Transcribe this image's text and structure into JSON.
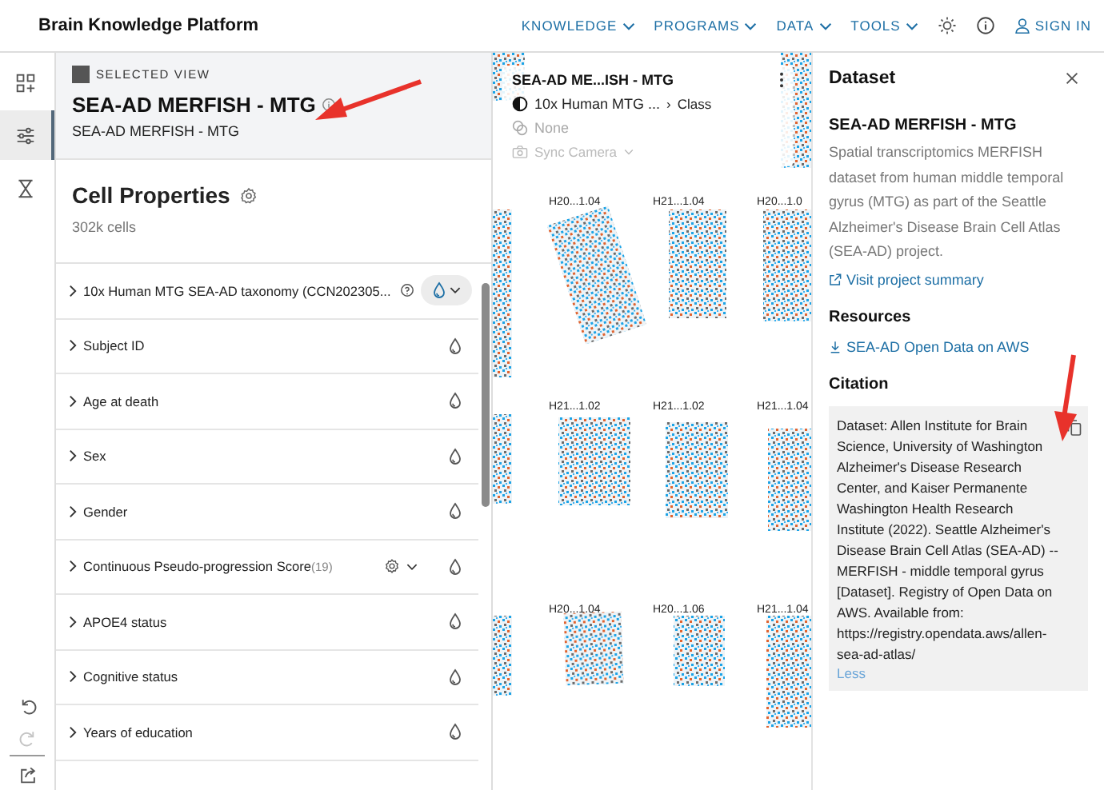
{
  "header": {
    "brand": "Brain Knowledge Platform",
    "nav": [
      {
        "label": "KNOWLEDGE"
      },
      {
        "label": "PROGRAMS"
      },
      {
        "label": "DATA"
      },
      {
        "label": "TOOLS"
      }
    ],
    "sign_in": "SIGN IN"
  },
  "rail": {
    "items": [
      {
        "kind": "grid",
        "selected": false
      },
      {
        "kind": "sliders",
        "selected": true
      },
      {
        "kind": "hourglass",
        "selected": false
      }
    ],
    "tools": [
      {
        "kind": "undo",
        "disabled": false
      },
      {
        "kind": "redo",
        "disabled": true
      },
      {
        "kind": "share",
        "disabled": false
      }
    ]
  },
  "selected_view": {
    "eyebrow": "SELECTED VIEW",
    "title": "SEA-AD MERFISH - MTG",
    "subtitle": "SEA-AD MERFISH - MTG"
  },
  "cell_properties": {
    "title": "Cell Properties",
    "count": "302k cells",
    "rows": [
      {
        "label": "10x Human MTG SEA-AD taxonomy (CCN202305...",
        "kind": "taxonomy",
        "color_by": true
      },
      {
        "label": "Subject ID",
        "kind": "plain",
        "color_by": false
      },
      {
        "label": "Age at death",
        "kind": "plain",
        "color_by": false
      },
      {
        "label": "Sex",
        "kind": "plain",
        "color_by": false
      },
      {
        "label": "Gender",
        "kind": "plain",
        "color_by": false
      },
      {
        "label": "Continuous Pseudo-progression Score",
        "count": "(19)",
        "kind": "continuous",
        "color_by": false
      },
      {
        "label": "APOE4 status",
        "kind": "plain",
        "color_by": false
      },
      {
        "label": "Cognitive status",
        "kind": "plain",
        "color_by": false
      },
      {
        "label": "Years of education",
        "kind": "plain",
        "color_by": false
      }
    ]
  },
  "viewer": {
    "card": {
      "title": "SEA-AD ME...ISH - MTG",
      "color_by": "10x Human MTG ...",
      "separator": "›",
      "color_level": "Class",
      "filter": "None",
      "sync": "Sync Camera"
    },
    "slide_labels": [
      {
        "text": "H20...1.04"
      },
      {
        "text": "H21...1.04"
      },
      {
        "text": "H20...1.0"
      },
      {
        "text": "H21...1.02"
      },
      {
        "text": "H21...1.02"
      },
      {
        "text": "H21...1.04"
      },
      {
        "text": "H20...1.04"
      },
      {
        "text": "H20...1.06"
      },
      {
        "text": "H21...1.04"
      }
    ]
  },
  "dataset": {
    "heading": "Dataset",
    "title": "SEA-AD MERFISH - MTG",
    "description": "Spatial transcriptomics MERFISH dataset from human middle temporal gyrus (MTG) as part of the Seattle Alzheimer's Disease Brain Cell Atlas (SEA-AD) project.",
    "summary_link": "Visit project summary",
    "resources_heading": "Resources",
    "resource_link": "SEA-AD Open Data on AWS",
    "citation_heading": "Citation",
    "citation": "Dataset: Allen Institute for Brain Science, University of Washington Alzheimer's Disease Research Center, and Kaiser Permanente Washington Health Research Institute (2022). Seattle Alzheimer's Disease Brain Cell Atlas (SEA-AD) -- MERFISH - middle temporal gyrus [Dataset]. Registry of Open Data on AWS. Available from: https://registry.opendata.aws/allen-sea-ad-atlas/",
    "less": "Less"
  }
}
